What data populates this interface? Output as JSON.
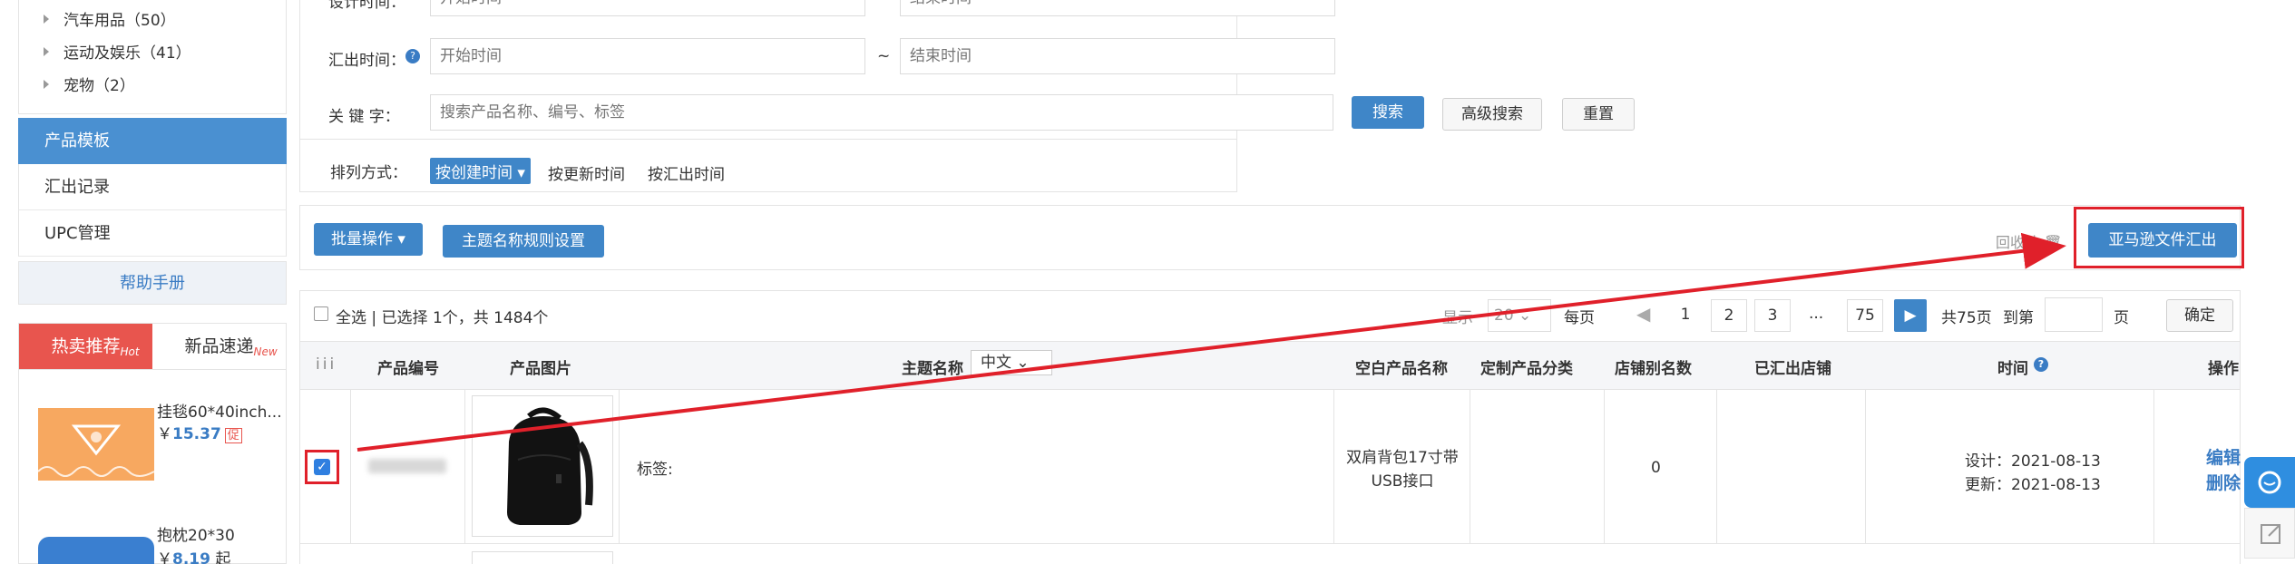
{
  "sidebar": {
    "categories": [
      {
        "label": "汽车用品（50）"
      },
      {
        "label": "运动及娱乐（41）"
      },
      {
        "label": "宠物（2）"
      }
    ],
    "menu": [
      {
        "label": "产品模板"
      },
      {
        "label": "汇出记录"
      },
      {
        "label": "UPC管理"
      }
    ],
    "help": "帮助手册",
    "promo": {
      "tabs": [
        {
          "label": "热卖推荐",
          "badge": "Hot"
        },
        {
          "label": "新品速递",
          "badge": "New"
        }
      ],
      "products": [
        {
          "name": "挂毯60*40inch...",
          "price_prefix": "￥",
          "price": "15.37",
          "tag": "促"
        },
        {
          "name": "抱枕20*30",
          "price_prefix": "￥",
          "price": "8.19",
          "tag": "起"
        }
      ]
    }
  },
  "filters": {
    "design_time": {
      "label": "设计时间：",
      "start_placeholder": "开始时间",
      "end_placeholder": "结束时间"
    },
    "export_time": {
      "label": "汇出时间：",
      "start_placeholder": "开始时间",
      "end_placeholder": "结束时间"
    },
    "separator": "~",
    "keyword": {
      "label": "关 键 字：",
      "placeholder": "搜索产品名称、编号、标签"
    },
    "search_btn": "搜索",
    "advanced_btn": "高级搜索",
    "reset_btn": "重置",
    "sort": {
      "label": "排列方式：",
      "options": [
        "按创建时间",
        "按更新时间",
        "按汇出时间"
      ],
      "active_index": 0
    }
  },
  "actions": {
    "bulk": "批量操作",
    "topic_rules": "主题名称规则设置",
    "recycle": "回收站",
    "amazon_export": "亚马逊文件汇出"
  },
  "selection": {
    "select_all": "全选",
    "summary": "| 已选择 1个，共 1484个"
  },
  "pagination": {
    "show_label": "显示",
    "page_size": "20",
    "per_page": "每页",
    "pages": [
      "1",
      "2",
      "3"
    ],
    "ellipsis": "...",
    "last": "75",
    "total": "共75页",
    "goto_label": "到第",
    "page_unit": "页",
    "confirm": "确定"
  },
  "table": {
    "headers": {
      "check": "iii",
      "code": "产品编号",
      "image": "产品图片",
      "topic": "主题名称",
      "lang": "中文",
      "blank_name": "空白产品名称",
      "category": "定制产品分类",
      "store_alias": "店铺别名数",
      "exported_store": "已汇出店铺",
      "time": "时间",
      "ops": "操作"
    },
    "rows": [
      {
        "checked": true,
        "tag_label": "标签:",
        "blank_name": "双肩背包17寸带USB接口",
        "store_alias": "0",
        "design": "设计：2021-08-13",
        "update": "更新：2021-08-13",
        "edit": "编辑",
        "delete": "删除"
      }
    ]
  },
  "colors": {
    "primary": "#3f86c8",
    "hot": "#e8554e",
    "annotation": "#e0202a"
  }
}
